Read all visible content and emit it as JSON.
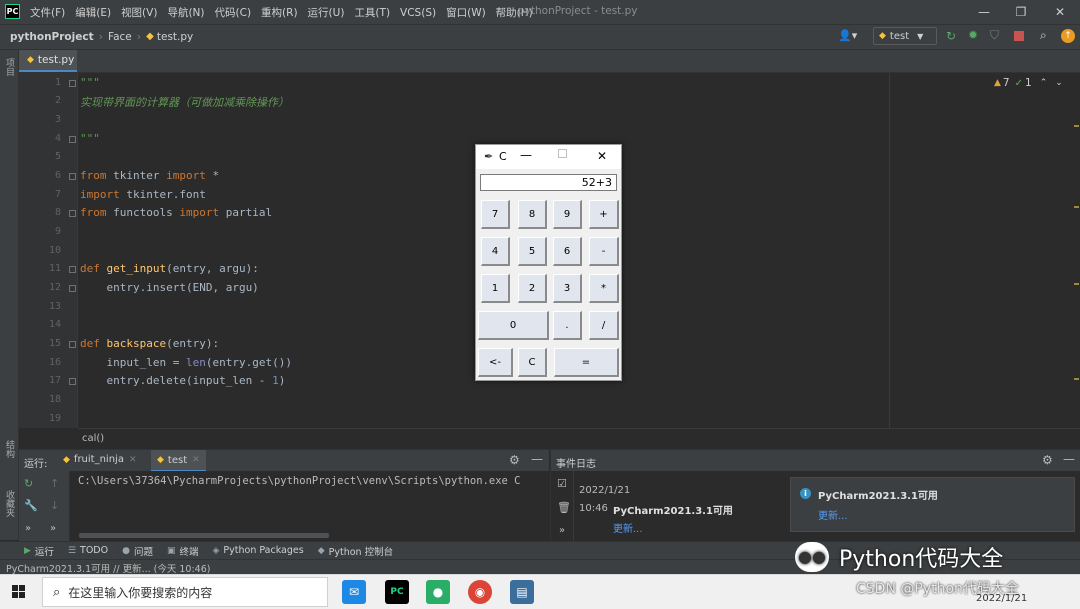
{
  "menu": [
    "文件(F)",
    "编辑(E)",
    "视图(V)",
    "导航(N)",
    "代码(C)",
    "重构(R)",
    "运行(U)",
    "工具(T)",
    "VCS(S)",
    "窗口(W)",
    "帮助(H)"
  ],
  "window_title": "pythonProject - test.py",
  "breadcrumb": {
    "project": "pythonProject",
    "folder": "Face",
    "file": "test.py"
  },
  "run_config": "test",
  "editor_tab": "test.py",
  "line_numbers": [
    "1",
    "2",
    "3",
    "4",
    "5",
    "6",
    "7",
    "8",
    "9",
    "10",
    "11",
    "12",
    "13",
    "14",
    "15",
    "16",
    "17",
    "18",
    "19"
  ],
  "code": {
    "l1": "\"\"\"",
    "l2": "实现带界面的计算器（可做加减乘除操作）",
    "l4": "\"\"\"",
    "l6a": "from",
    "l6b": " tkinter ",
    "l6c": "import",
    "l6d": " *",
    "l7a": "import",
    "l7b": " tkinter.font",
    "l8a": "from",
    "l8b": " functools ",
    "l8c": "import",
    "l8d": " partial",
    "l11a": "def",
    "l11b": "get_input",
    "l11c": "(entry, argu):",
    "l12": "    entry.insert(END, argu)",
    "l15a": "def",
    "l15b": "backspace",
    "l15c": "(entry):",
    "l16a": "    input_len = ",
    "l16b": "len",
    "l16c": "(entry.get())",
    "l17a": "    entry.delete(input_len - ",
    "l17b": "1",
    "l17c": ")"
  },
  "inspections": {
    "warnings": "7",
    "ok": "1"
  },
  "breadcrumb_fn": "cal()",
  "run_panel": {
    "label": "运行:",
    "tabs": [
      "fruit_ninja",
      "test"
    ],
    "output": "C:\\Users\\37364\\PycharmProjects\\pythonProject\\venv\\Scripts\\python.exe C"
  },
  "event_log": {
    "title": "事件日志",
    "date": "2022/1/21",
    "time": "10:46",
    "message": "PyCharm2021.3.1可用",
    "link": "更新..."
  },
  "notification": {
    "title": "PyCharm2021.3.1可用",
    "link": "更新..."
  },
  "tool_tabs": [
    "运行",
    "TODO",
    "问题",
    "终端",
    "Python Packages",
    "Python 控制台"
  ],
  "statusbar": "PyCharm2021.3.1可用 // 更新... (今天 10:46)",
  "left_vertical": [
    "项目",
    "结构",
    "收藏夹"
  ],
  "taskbar": {
    "search_placeholder": "在这里输入你要搜索的内容",
    "date": "2022/1/21"
  },
  "calculator": {
    "title": "C",
    "display": "52+3",
    "rows": [
      [
        "7",
        "8",
        "9",
        "+"
      ],
      [
        "4",
        "5",
        "6",
        "-"
      ],
      [
        "1",
        "2",
        "3",
        "*"
      ],
      [
        "0",
        ".",
        "/"
      ],
      [
        "<-",
        "C",
        "="
      ]
    ]
  },
  "watermark": {
    "main": "Python代码大全",
    "sub": "CSDN @Python代码大全"
  },
  "colors": {
    "accent": "#4a88c7",
    "background": "#2b2b2b",
    "keyword": "#cc7832",
    "docstring": "#629755"
  }
}
